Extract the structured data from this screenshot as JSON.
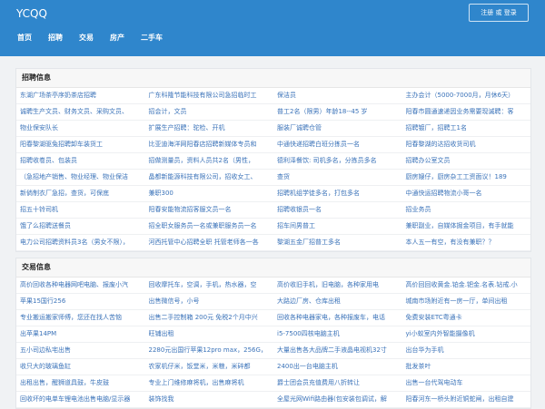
{
  "header": {
    "logo": "YCQQ",
    "register_login": "注册 或 登录",
    "nav": [
      "首页",
      "招聘",
      "交易",
      "房产",
      "二手车"
    ]
  },
  "sections": [
    {
      "title": "招聘信息",
      "items": [
        "东湖广场茶亭序奶茶店招聘",
        "广东科隆节能科技有限公司急招临时工",
        "保洁员",
        "主办会计（5000-7000月，月休6天）",
        "诚聘生产文员、财务文员、采购文员、",
        "招会计，文员",
        "普工2名（限男）年龄18--45 岁",
        "阳春市圆通速递因业务需要现诚聘：客",
        "物业保安队长",
        "扩展生产招聘：驼检、开机",
        "服装厂诚聘仓管",
        "招聘镀厂，招聘工1名",
        "阳春黎湖驱兔招聘卸车装货工",
        "比亚迪海洋网阳春店招聘新媒体专员和",
        "中通快递招聘白班分拣员一名",
        "阳春黎湖的达招收货司机",
        "招聘收卷员、包装员",
        "招做测量员，资料人员共2名（男性，",
        "德利泽餐饮: 司机多名，分拣员多名",
        "招聘办公室文员",
        "（急招地产销售、物业经理、物业保洁",
        "晶都新能源科技有限公司，招收女工、",
        "查货",
        "厨房嫂仔，厨房杂工工资面议！189",
        "新倘制衣厂急招，查货，可保底",
        "兼职300",
        "招聘机组学徒多名，打包多名",
        "中通快运招聘物流小哥一名",
        "招五十铃司机",
        "阳春安能物流招客服文员一名",
        "招聘收银员一名",
        "招业务员",
        "饿了么招聘送餐员",
        "招全职女服务员一名或兼职服务员一名",
        "招车间男普工",
        "兼职副业，自媒体掘金项目，有手就能",
        "电力公司招聘资料员3名（男女不限），",
        "河西托管中心招聘全职 托管老师各一各",
        "黎湖五金厂招普工多名",
        "本人五一有空，有没有兼职？？"
      ]
    },
    {
      "title": "交易信息",
      "items": [
        "高价回收各种电器网吧电脑、报废小汽",
        "回收摩托车，空调，手机，热水器，空",
        "高价收旧手机，旧电脑，各种家用电",
        "高价回回收黄金.铂金.钯金.名表.钻戒.小",
        "苹果15国行256",
        "出售微信号，小号",
        "大路边厂房、仓库出租",
        "城南市场附近有一房一厅，单间出租",
        "专业搬运搬家师傅，您还在找人苦恼",
        "出售二手控制箱 200元 免税2个月中兴",
        "回收各种电器家电，各种报废车，电话",
        "免费安装ETC粤通卡",
        "出苹果14PM",
        "旺铺出租",
        "i5-7500四核电脑主机",
        "yi小蚁室内外智能摄像机",
        "五小司边私宅出售",
        "2280元出国行苹果12pro max，256G，",
        "大量出售各大品牌二手液晶电视机32寸",
        "出台华为手机",
        "收只大的玻璃鱼缸",
        "农家机仔米，饭堂米，米粮，米碎都",
        "2400出一台电脑主机",
        "批发茶叶",
        "出租出售，醒狮道具鼓，牛皮鼓",
        "专业上门维修麻将机，出售麻将机",
        "爵士团会员充值费用八折转让",
        "出售一台代驾电动车",
        "回收坏的电单车锂电池出售电脑/显示器",
        "装饰找我",
        "全屋光网Wifi路由器(包安装包调试，解",
        "阳春河东一桥头附近铜蛇闸，出租自建"
      ]
    }
  ]
}
